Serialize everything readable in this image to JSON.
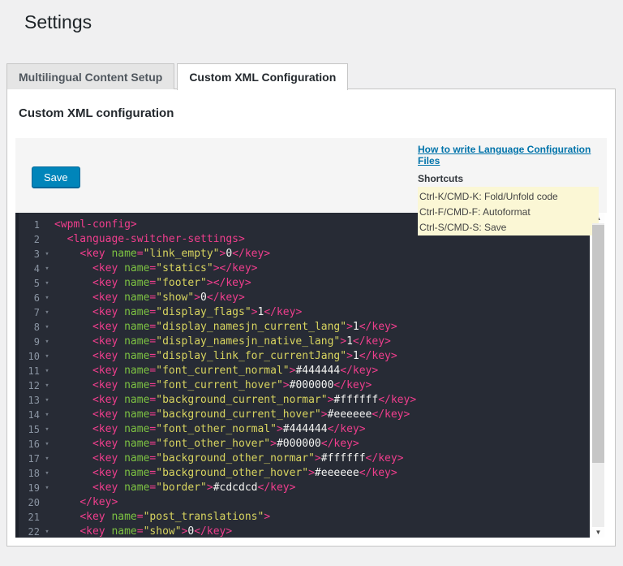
{
  "page": {
    "title": "Settings"
  },
  "tabs": [
    {
      "label": "Multilingual Content Setup",
      "active": false
    },
    {
      "label": "Custom XML Configuration",
      "active": true
    }
  ],
  "panel": {
    "heading": "Custom XML configuration",
    "save_label": "Save",
    "help_link_label": "How to write Language Configuration Files",
    "shortcuts_title": "Shortcuts",
    "shortcuts": [
      "Ctrl-K/CMD-K: Fold/Unfold code",
      "Ctrl-F/CMD-F: Autoformat",
      "Ctrl-S/CMD-S: Save"
    ]
  },
  "editor": {
    "fold_icon": "▾",
    "scroll_up_icon": "▲",
    "scroll_down_icon": "▼",
    "lines": [
      {
        "number": 1,
        "indent": 0,
        "fold": false,
        "tokens": [
          [
            "t",
            "<wpml-config>"
          ]
        ]
      },
      {
        "number": 2,
        "indent": 2,
        "fold": false,
        "tokens": [
          [
            "t",
            "<language-switcher-settings>"
          ]
        ]
      },
      {
        "number": 3,
        "indent": 4,
        "fold": true,
        "tokens": [
          [
            "t",
            "<key "
          ],
          [
            "a",
            "name"
          ],
          [
            "t",
            "="
          ],
          [
            "s",
            "\"link_empty\""
          ],
          [
            "t",
            ">"
          ],
          [
            "v",
            "0"
          ],
          [
            "t",
            "</key>"
          ]
        ]
      },
      {
        "number": 4,
        "indent": 6,
        "fold": true,
        "tokens": [
          [
            "t",
            "<key "
          ],
          [
            "a",
            "name"
          ],
          [
            "t",
            "="
          ],
          [
            "s",
            "\"statics\""
          ],
          [
            "t",
            "></key>"
          ]
        ]
      },
      {
        "number": 5,
        "indent": 6,
        "fold": true,
        "tokens": [
          [
            "t",
            "<key "
          ],
          [
            "a",
            "name"
          ],
          [
            "t",
            "="
          ],
          [
            "s",
            "\"footer\""
          ],
          [
            "t",
            "></key>"
          ]
        ]
      },
      {
        "number": 6,
        "indent": 6,
        "fold": true,
        "tokens": [
          [
            "t",
            "<key "
          ],
          [
            "a",
            "name"
          ],
          [
            "t",
            "="
          ],
          [
            "s",
            "\"show\""
          ],
          [
            "t",
            ">"
          ],
          [
            "v",
            "0"
          ],
          [
            "t",
            "</key>"
          ]
        ]
      },
      {
        "number": 7,
        "indent": 6,
        "fold": true,
        "tokens": [
          [
            "t",
            "<key "
          ],
          [
            "a",
            "name"
          ],
          [
            "t",
            "="
          ],
          [
            "s",
            "\"display_flags\""
          ],
          [
            "t",
            ">"
          ],
          [
            "v",
            "1"
          ],
          [
            "t",
            "</key>"
          ]
        ]
      },
      {
        "number": 8,
        "indent": 6,
        "fold": true,
        "tokens": [
          [
            "t",
            "<key "
          ],
          [
            "a",
            "name"
          ],
          [
            "t",
            "="
          ],
          [
            "s",
            "\"display_namesjn_current_lang\""
          ],
          [
            "t",
            ">"
          ],
          [
            "v",
            "1"
          ],
          [
            "t",
            "</key>"
          ]
        ]
      },
      {
        "number": 9,
        "indent": 6,
        "fold": true,
        "tokens": [
          [
            "t",
            "<key "
          ],
          [
            "a",
            "name"
          ],
          [
            "t",
            "="
          ],
          [
            "s",
            "\"display_namesjn_native_lang\""
          ],
          [
            "t",
            ">"
          ],
          [
            "v",
            "1"
          ],
          [
            "t",
            "</key>"
          ]
        ]
      },
      {
        "number": 10,
        "indent": 6,
        "fold": true,
        "tokens": [
          [
            "t",
            "<key "
          ],
          [
            "a",
            "name"
          ],
          [
            "t",
            "="
          ],
          [
            "s",
            "\"display_link_for_currentJang\""
          ],
          [
            "t",
            ">"
          ],
          [
            "v",
            "1"
          ],
          [
            "t",
            "</key>"
          ]
        ]
      },
      {
        "number": 11,
        "indent": 6,
        "fold": true,
        "tokens": [
          [
            "t",
            "<key "
          ],
          [
            "a",
            "name"
          ],
          [
            "t",
            "="
          ],
          [
            "s",
            "\"font_current_normal\""
          ],
          [
            "t",
            ">"
          ],
          [
            "v",
            "#444444"
          ],
          [
            "t",
            "</key>"
          ]
        ]
      },
      {
        "number": 12,
        "indent": 6,
        "fold": true,
        "tokens": [
          [
            "t",
            "<key "
          ],
          [
            "a",
            "name"
          ],
          [
            "t",
            "="
          ],
          [
            "s",
            "\"font_current_hover\""
          ],
          [
            "t",
            ">"
          ],
          [
            "v",
            "#000000"
          ],
          [
            "t",
            "</key>"
          ]
        ]
      },
      {
        "number": 13,
        "indent": 6,
        "fold": true,
        "tokens": [
          [
            "t",
            "<key "
          ],
          [
            "a",
            "name"
          ],
          [
            "t",
            "="
          ],
          [
            "s",
            "\"background_current_normar\""
          ],
          [
            "t",
            ">"
          ],
          [
            "v",
            "#ffffff"
          ],
          [
            "t",
            "</key>"
          ]
        ]
      },
      {
        "number": 14,
        "indent": 6,
        "fold": true,
        "tokens": [
          [
            "t",
            "<key "
          ],
          [
            "a",
            "name"
          ],
          [
            "t",
            "="
          ],
          [
            "s",
            "\"background_current_hover\""
          ],
          [
            "t",
            ">"
          ],
          [
            "v",
            "#eeeeee"
          ],
          [
            "t",
            "</key>"
          ]
        ]
      },
      {
        "number": 15,
        "indent": 6,
        "fold": true,
        "tokens": [
          [
            "t",
            "<key "
          ],
          [
            "a",
            "name"
          ],
          [
            "t",
            "="
          ],
          [
            "s",
            "\"font_other_normal\""
          ],
          [
            "t",
            ">"
          ],
          [
            "v",
            "#444444"
          ],
          [
            "t",
            "</key>"
          ]
        ]
      },
      {
        "number": 16,
        "indent": 6,
        "fold": true,
        "tokens": [
          [
            "t",
            "<key "
          ],
          [
            "a",
            "name"
          ],
          [
            "t",
            "="
          ],
          [
            "s",
            "\"font_other_hover\""
          ],
          [
            "t",
            ">"
          ],
          [
            "v",
            "#000000"
          ],
          [
            "t",
            "</key>"
          ]
        ]
      },
      {
        "number": 17,
        "indent": 6,
        "fold": true,
        "tokens": [
          [
            "t",
            "<key "
          ],
          [
            "a",
            "name"
          ],
          [
            "t",
            "="
          ],
          [
            "s",
            "\"background_other_normar\""
          ],
          [
            "t",
            ">"
          ],
          [
            "v",
            "#ffffff"
          ],
          [
            "t",
            "</key>"
          ]
        ]
      },
      {
        "number": 18,
        "indent": 6,
        "fold": true,
        "tokens": [
          [
            "t",
            "<key "
          ],
          [
            "a",
            "name"
          ],
          [
            "t",
            "="
          ],
          [
            "s",
            "\"background_other_hover\""
          ],
          [
            "t",
            ">"
          ],
          [
            "v",
            "#eeeeee"
          ],
          [
            "t",
            "</key>"
          ]
        ]
      },
      {
        "number": 19,
        "indent": 6,
        "fold": true,
        "tokens": [
          [
            "t",
            "<key "
          ],
          [
            "a",
            "name"
          ],
          [
            "t",
            "="
          ],
          [
            "s",
            "\"border\""
          ],
          [
            "t",
            ">"
          ],
          [
            "v",
            "#cdcdcd"
          ],
          [
            "t",
            "</key>"
          ]
        ]
      },
      {
        "number": 20,
        "indent": 4,
        "fold": false,
        "tokens": [
          [
            "t",
            "</key>"
          ]
        ]
      },
      {
        "number": 21,
        "indent": 4,
        "fold": false,
        "tokens": [
          [
            "t",
            "<key "
          ],
          [
            "a",
            "name"
          ],
          [
            "t",
            "="
          ],
          [
            "s",
            "\"post_translations\""
          ],
          [
            "t",
            ">"
          ]
        ]
      },
      {
        "number": 22,
        "indent": 4,
        "fold": true,
        "tokens": [
          [
            "t",
            "<key "
          ],
          [
            "a",
            "name"
          ],
          [
            "t",
            "="
          ],
          [
            "s",
            "\"show\""
          ],
          [
            "t",
            ">"
          ],
          [
            "v",
            "0"
          ],
          [
            "t",
            "</key>"
          ]
        ]
      }
    ]
  },
  "theme": {
    "accent-blue": "#0085ba",
    "accent-blue-dark": "#006799",
    "link-blue": "#0073aa",
    "yellow-bg": "#fbf7d5",
    "editor-bg": "#272b35",
    "line-number": "#8b95a3",
    "tok-tag": "#f03e8d",
    "tok-attr": "#7dc242",
    "tok-str": "#d8d45f",
    "tok-text": "#f4f4f2"
  }
}
